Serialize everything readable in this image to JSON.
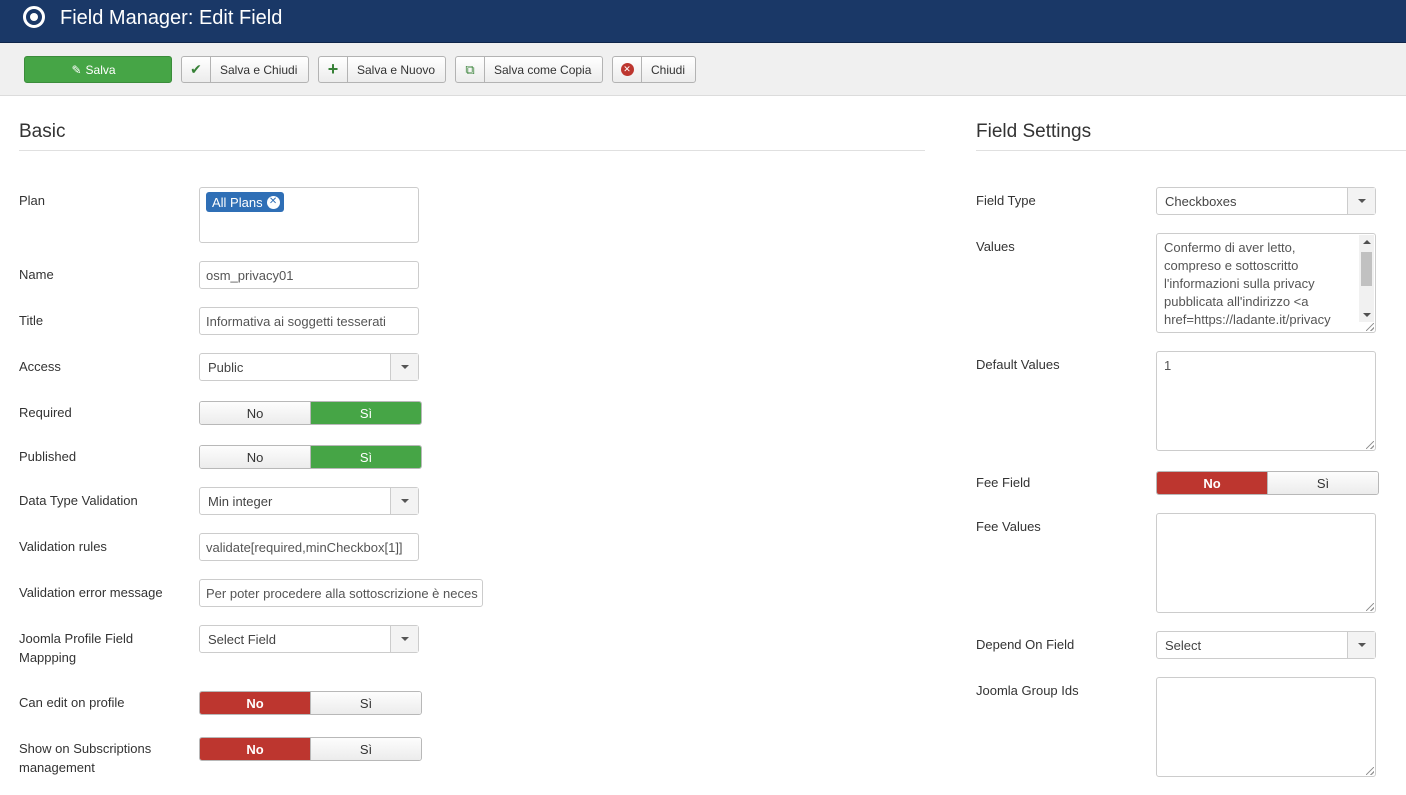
{
  "header": {
    "title": "Field Manager: Edit Field",
    "logo_icon": "joomla-target-icon"
  },
  "toolbar": {
    "save": "Salva",
    "save_close": "Salva e Chiudi",
    "save_new": "Salva e Nuovo",
    "save_copy": "Salva come Copia",
    "close": "Chiudi"
  },
  "basic": {
    "title": "Basic",
    "plan": {
      "label": "Plan",
      "tag": "All Plans"
    },
    "name": {
      "label": "Name",
      "value": "osm_privacy01"
    },
    "title_field": {
      "label": "Title",
      "value": "Informativa ai soggetti tesserati"
    },
    "access": {
      "label": "Access",
      "value": "Public"
    },
    "required": {
      "label": "Required",
      "no": "No",
      "yes": "Sì",
      "selected": "yes"
    },
    "published": {
      "label": "Published",
      "no": "No",
      "yes": "Sì",
      "selected": "yes"
    },
    "data_type_validation": {
      "label": "Data Type Validation",
      "value": "Min integer"
    },
    "validation_rules": {
      "label": "Validation rules",
      "value": "validate[required,minCheckbox[1]]"
    },
    "validation_error": {
      "label": "Validation error message",
      "value": "Per poter procedere alla sottoscrizione è neces"
    },
    "joomla_profile": {
      "label_line1": "Joomla Profile Field",
      "label_line2": "Mappping",
      "value": "Select Field"
    },
    "can_edit_profile": {
      "label": "Can edit on profile",
      "no": "No",
      "yes": "Sì",
      "selected": "no"
    },
    "show_subscriptions": {
      "label_line1": "Show on Subscriptions",
      "label_line2": "management",
      "no": "No",
      "yes": "Sì",
      "selected": "no"
    }
  },
  "settings": {
    "title": "Field Settings",
    "field_type": {
      "label": "Field Type",
      "value": "Checkboxes"
    },
    "values": {
      "label": "Values",
      "lines": [
        "Confermo di aver letto,",
        "compreso e sottoscritto",
        "l'informazioni sulla privacy",
        "pubblicata all'indirizzo <a",
        "href=https://ladante.it/privacy"
      ]
    },
    "default_values": {
      "label": "Default Values",
      "value": "1"
    },
    "fee_field": {
      "label": "Fee Field",
      "no": "No",
      "yes": "Sì",
      "selected": "no"
    },
    "fee_values": {
      "label": "Fee Values",
      "value": ""
    },
    "depend_on_field": {
      "label": "Depend On Field",
      "value": "Select"
    },
    "joomla_group_ids": {
      "label": "Joomla Group Ids",
      "value": ""
    }
  },
  "colors": {
    "header_bg": "#1a3867",
    "green": "#46a546",
    "red": "#bd362f",
    "tag_blue": "#2f6fb6"
  }
}
